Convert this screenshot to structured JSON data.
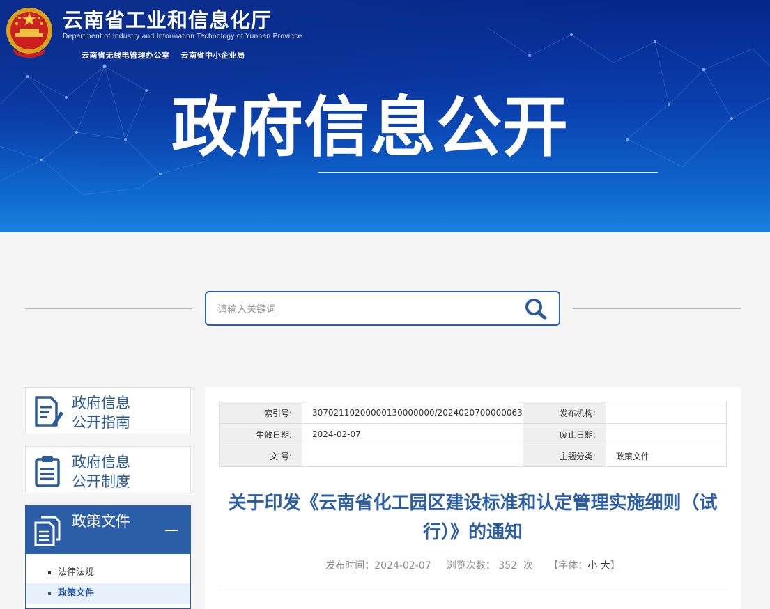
{
  "header": {
    "org_name": "云南省工业和信息化厅",
    "org_name_en": "Department of Industry and Information Technology of Yunnan Province",
    "sub_links": [
      "云南省无线电管理办公室",
      "云南省中小企业局"
    ],
    "hero_title": "政府信息公开"
  },
  "search": {
    "placeholder": "请输入关键词"
  },
  "sidebar": {
    "items": [
      {
        "label": "政府信息\n公开指南",
        "icon": "document-pen-icon"
      },
      {
        "label": "政府信息\n公开制度",
        "icon": "clipboard-list-icon"
      },
      {
        "label": "政策文件",
        "icon": "stacked-documents-icon",
        "active": true
      }
    ],
    "submenu": [
      "法律法规",
      "政策文件"
    ]
  },
  "meta": {
    "index_no_label": "索引号:",
    "index_no": "30702110200000130000000/2024020700000063",
    "publisher_label": "发布机构:",
    "publisher": "",
    "effective_date_label": "生效日期:",
    "effective_date": "2024-02-07",
    "repeal_date_label": "废止日期:",
    "repeal_date": "",
    "doc_no_label": "文 号:",
    "doc_no": "",
    "topic_label": "主题分类:",
    "topic": "政策文件"
  },
  "article": {
    "title": "关于印发《云南省化工园区建设标准和认定管理实施细则（试行）》的通知",
    "publish_label": "发布时间：",
    "publish_time": "2024-02-07",
    "views_label": "浏览次数：",
    "views": "352",
    "views_unit": "次",
    "font_label": "【字体：",
    "font_small": "小",
    "font_large": "大",
    "font_close": "】"
  },
  "colors": {
    "accent": "#2c5ea8",
    "banner_dark": "#06268a",
    "banner_light": "#1a82df"
  }
}
